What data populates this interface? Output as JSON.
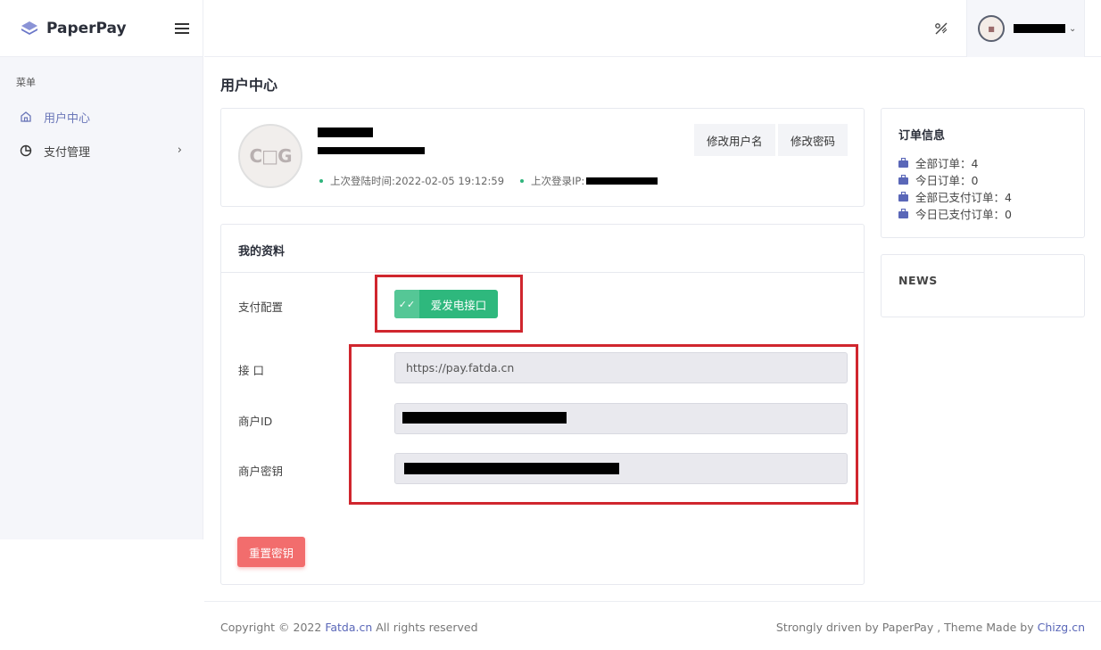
{
  "app": {
    "name": "PaperPay"
  },
  "sidebar": {
    "section_title": "菜单",
    "items": [
      {
        "label": "用户中心",
        "icon": "home-icon"
      },
      {
        "label": "支付管理",
        "icon": "pie-chart-icon"
      }
    ]
  },
  "page": {
    "title": "用户中心"
  },
  "profile": {
    "edit_username_label": "修改用户名",
    "edit_password_label": "修改密码",
    "last_login_time": "上次登陆时间:2022-02-05 19:12:59",
    "last_login_ip_label": "上次登录IP:"
  },
  "my_data": {
    "title": "我的资料",
    "payment_config_label": "支付配置",
    "payment_button_label": "爱发电接口",
    "api_label": "接 口",
    "api_value": "https://pay.fatda.cn",
    "merchant_id_label": "商户ID",
    "merchant_key_label": "商户密钥",
    "reset_key_label": "重置密钥"
  },
  "orders": {
    "title": "订单信息",
    "lines": [
      "全部订单：4",
      "今日订单：0",
      "全部已支付订单：4",
      "今日已支付订单：0"
    ]
  },
  "news": {
    "title": "NEWS"
  },
  "footer": {
    "copyright_prefix": "Copyright © 2022 ",
    "copyright_link": "Fatda.cn",
    "copyright_suffix": " All rights reserved",
    "right_prefix": "Strongly driven by PaperPay , Theme Made by ",
    "right_link": "Chizg.cn"
  },
  "colors": {
    "accent": "#2eb87d",
    "danger": "#f26d6d",
    "link": "#5a67b8",
    "highlight_box": "#d0262e"
  }
}
